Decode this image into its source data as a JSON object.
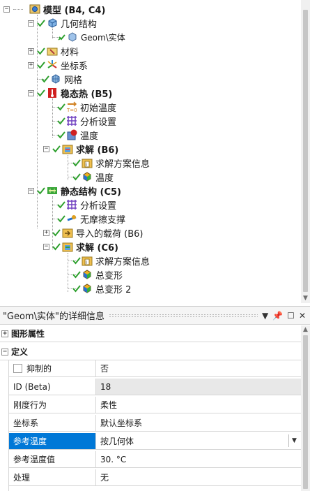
{
  "tree": {
    "root": "模型 (B4, C4)",
    "geometry": "几何结构",
    "geom_solid": "Geom\\实体",
    "materials": "材料",
    "coord_systems": "坐标系",
    "mesh": "网格",
    "steady_thermal": "稳态热 (B5)",
    "initial_temp": "初始温度",
    "analysis_settings_1": "分析设置",
    "temperature": "温度",
    "solution_b6": "求解 (B6)",
    "solution_info_1": "求解方案信息",
    "temperature_result": "温度",
    "static_structural": "静态结构 (C5)",
    "analysis_settings_2": "分析设置",
    "frictionless_support": "无摩擦支撑",
    "imported_load": "导入的载荷 (B6)",
    "solution_c6": "求解 (C6)",
    "solution_info_2": "求解方案信息",
    "total_deformation": "总变形",
    "total_deformation_2": "总变形 2"
  },
  "details": {
    "title": "\"Geom\\实体\"的详细信息",
    "pin": "ꟻ",
    "sections": {
      "graphics": "图形属性",
      "definition": "定义"
    },
    "rows": [
      {
        "key": "抑制的",
        "value": "否"
      },
      {
        "key": "ID (Beta)",
        "value": "18"
      },
      {
        "key": "刚度行为",
        "value": "柔性"
      },
      {
        "key": "坐标系",
        "value": "默认坐标系"
      },
      {
        "key": "参考温度",
        "value": "按几何体"
      },
      {
        "key": "参考温度值",
        "value": "30. °C"
      },
      {
        "key": "处理",
        "value": "无"
      }
    ]
  },
  "colors": {
    "selection": "#0078d7",
    "check_green": "#2ea02e",
    "thermal_red": "#d02020",
    "structural_green": "#3aa63a"
  }
}
